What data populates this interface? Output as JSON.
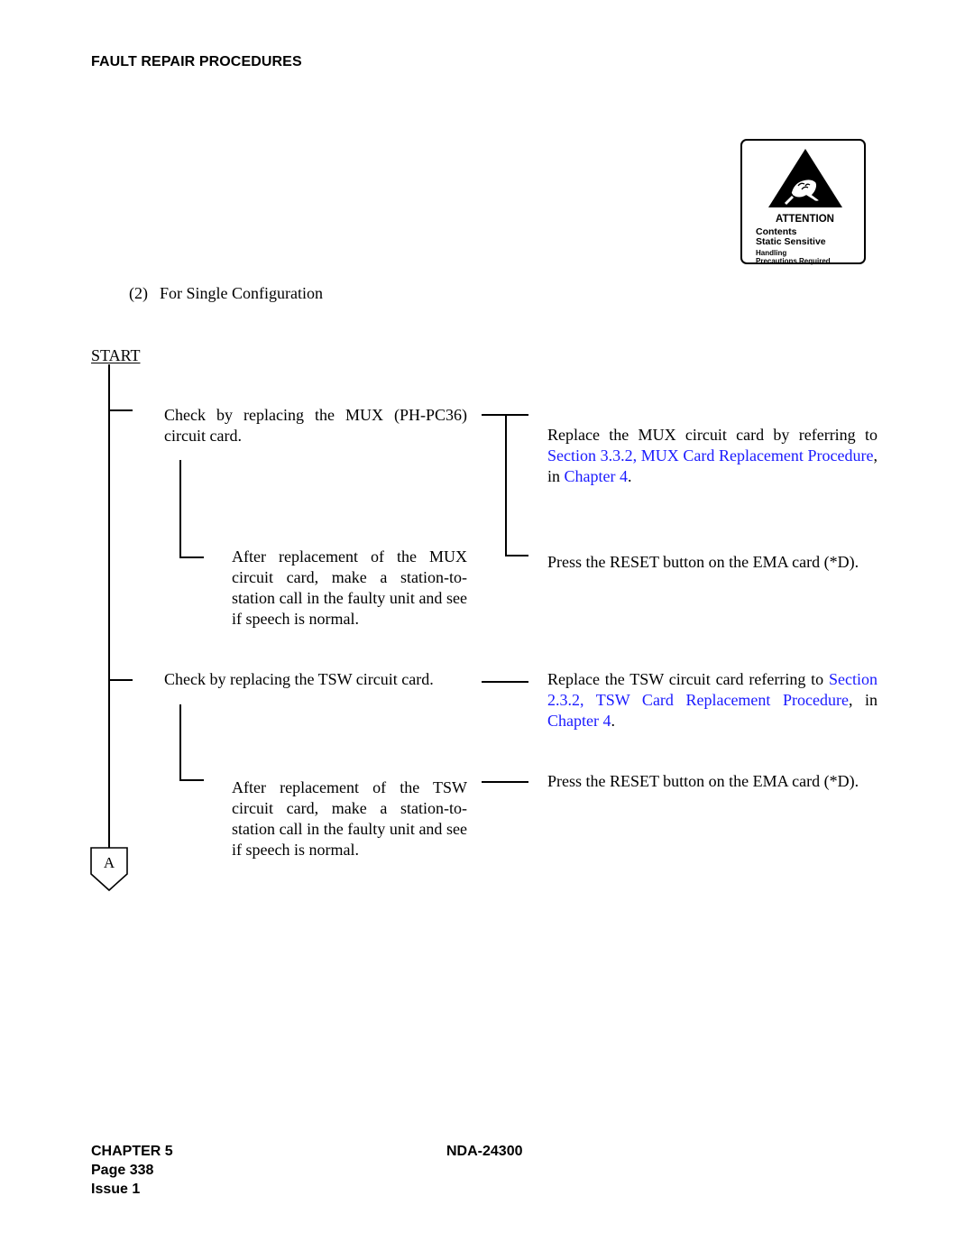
{
  "header": {
    "section_title": "FAULT REPAIR PROCEDURES"
  },
  "attention_label": {
    "icon": "esd-hand-warning-icon",
    "title": "ATTENTION",
    "line1": "Contents",
    "line2": "Static Sensitive",
    "line3": "Handling",
    "line4": "Precautions Required"
  },
  "subsection": {
    "number": "(2)",
    "title": "For Single Configuration"
  },
  "flowchart": {
    "start_label": "START",
    "mux_check": "Check by replacing the MUX (PH-PC36) circuit card.",
    "mux_replace": {
      "text_before": "Replace the MUX circuit card by referring to ",
      "link1": "Section 3.3.2, MUX Card Replacement Procedure",
      "text_middle": ", in ",
      "link2": "Chapter 4",
      "text_after": "."
    },
    "mux_after": "After replacement of the MUX circuit card, make a station-to-station call in the faulty unit and see if speech is normal.",
    "mux_reset": "Press the RESET button on the EMA card (*D).",
    "tsw_check": "Check by replacing the TSW circuit card.",
    "tsw_replace": {
      "text_before": "Replace the TSW circuit card referring to ",
      "link1": "Section 2.3.2, TSW Card Replacement Procedure",
      "text_middle": ", in ",
      "link2": "Chapter 4",
      "text_after": "."
    },
    "tsw_after": "After replacement of the TSW circuit card, make a station-to-station call in the faulty unit and see if speech is normal.",
    "tsw_reset": "Press the RESET button on the EMA card (*D).",
    "connector_label": "A"
  },
  "footer": {
    "chapter": "CHAPTER 5",
    "page": "Page 338",
    "issue": "Issue 1",
    "doc_number": "NDA-24300"
  },
  "colors": {
    "link": "#1a1aff",
    "text": "#000000"
  }
}
